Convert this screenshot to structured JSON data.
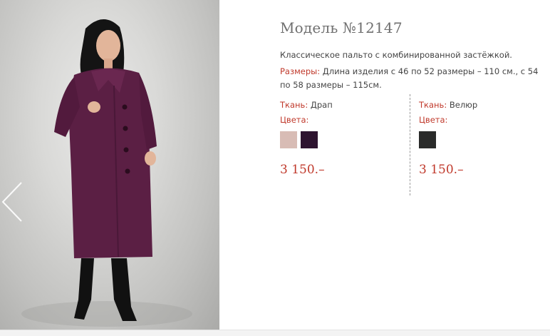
{
  "product": {
    "title": "Модель №12147",
    "description": "Классическое пальто с комбинированной застёжкой.",
    "sizes_label": "Размеры:",
    "sizes_text": " Длина изделия с 46 по 52 размеры – 110 см., с 54 по 58 размеры – 115см."
  },
  "variants": [
    {
      "fabric_label": "Ткань:",
      "fabric": " Драп",
      "colors_label": "Цвета:",
      "colors": [
        "#d8bcb5",
        "#2e1430"
      ],
      "price": "3 150.–"
    },
    {
      "fabric_label": "Ткань:",
      "fabric": " Велюр",
      "colors_label": "Цвета:",
      "colors": [
        "#2a2b2a"
      ],
      "price": "3 150.–"
    }
  ],
  "colors": {
    "accent": "#c0392b",
    "title": "#6f6f6f",
    "coat": "#5b1f44"
  },
  "icons": {
    "prev": "chevron-left-icon"
  }
}
